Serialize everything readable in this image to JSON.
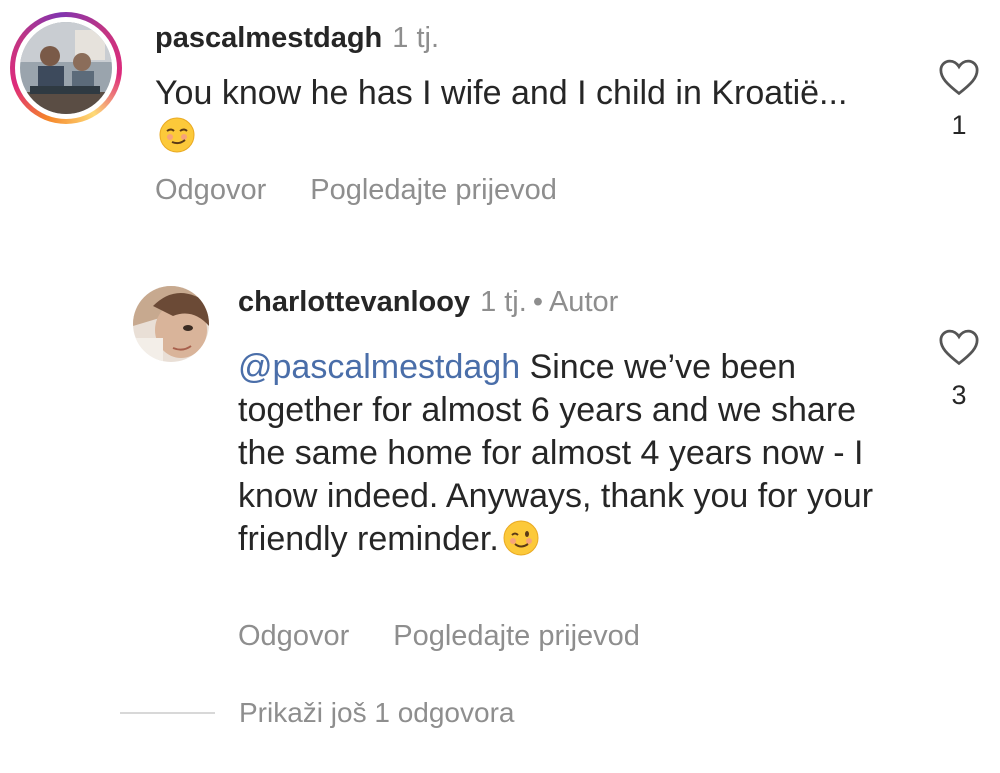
{
  "comments": [
    {
      "username": "pascalmestdagh",
      "time": "1 tj.",
      "text": "You know he has I wife and I child in Kroatië...",
      "emoji": "smirk-face-emoji",
      "likes": "1",
      "reply_label": "Odgovor",
      "translate_label": "Pogledajte prijevod"
    },
    {
      "username": "charlottevanlooy",
      "time": "1 tj.",
      "separator": "•",
      "author_label": "Autor",
      "mention": "@pascalmestdagh",
      "text": " Since we’ve been together for almost 6 years and we share the same home for almost 4 years now - I know indeed. Anyways, thank you for your friendly reminder.",
      "emoji": "winking-face-emoji",
      "likes": "3",
      "reply_label": "Odgovor",
      "translate_label": "Pogledajte prijevod"
    }
  ],
  "show_more_replies": "Prikaži još 1 odgovora",
  "colors": {
    "mention": "#4a6ea9",
    "muted": "#8e8e8e",
    "text": "#262626"
  }
}
